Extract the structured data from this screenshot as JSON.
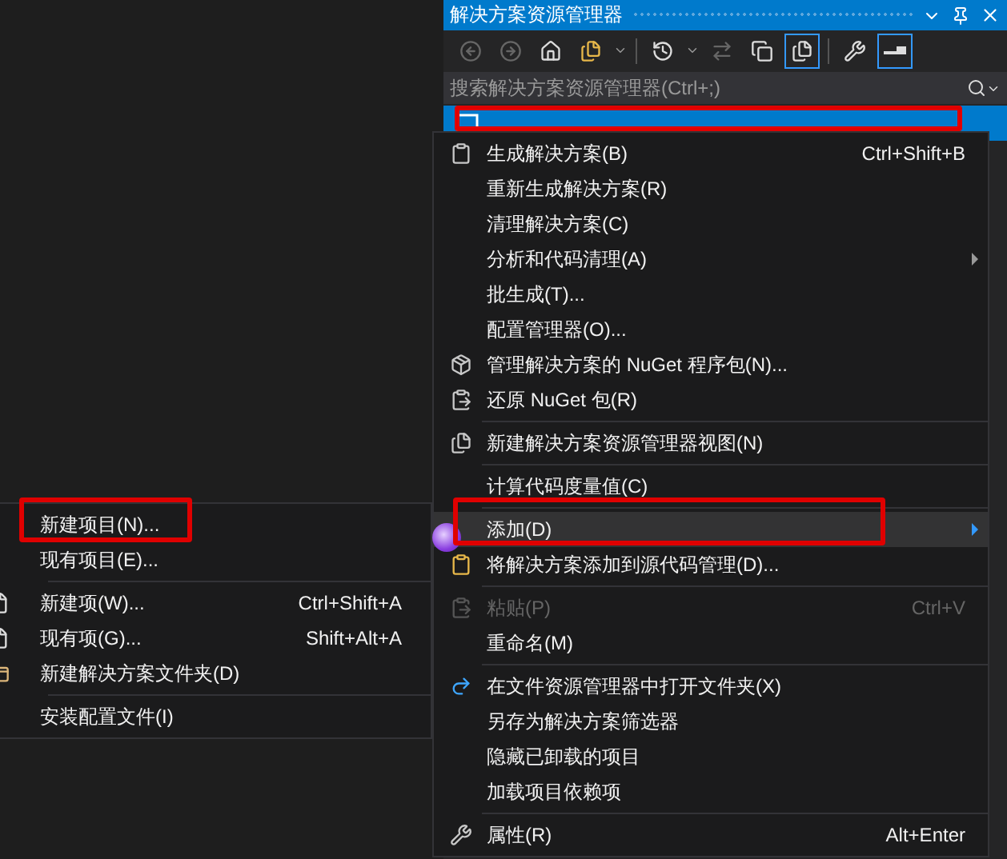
{
  "panel": {
    "title": "解决方案资源管理器",
    "search": {
      "placeholder": "搜索解决方案资源管理器(Ctrl+;)"
    },
    "tree_row": {
      "selected": true
    }
  },
  "context_menu": {
    "items": [
      {
        "kind": "item",
        "label": "生成解决方案(B)",
        "shortcut": "Ctrl+Shift+B",
        "selected": false,
        "disabled": false
      },
      {
        "kind": "item",
        "label": "重新生成解决方案(R)",
        "selected": false,
        "disabled": false
      },
      {
        "kind": "item",
        "label": "清理解决方案(C)",
        "selected": false,
        "disabled": false
      },
      {
        "kind": "item",
        "label": "分析和代码清理(A)",
        "submenu": true,
        "selected": false,
        "disabled": false
      },
      {
        "kind": "item",
        "label": "批生成(T)...",
        "selected": false,
        "disabled": false
      },
      {
        "kind": "item",
        "label": "配置管理器(O)...",
        "selected": false,
        "disabled": false
      },
      {
        "kind": "item",
        "label": "管理解决方案的 NuGet 程序包(N)...",
        "selected": false,
        "disabled": false
      },
      {
        "kind": "item",
        "label": "还原 NuGet 包(R)",
        "selected": false,
        "disabled": false
      },
      {
        "kind": "separator"
      },
      {
        "kind": "item",
        "label": "新建解决方案资源管理器视图(N)",
        "selected": false,
        "disabled": false
      },
      {
        "kind": "separator"
      },
      {
        "kind": "item",
        "label": "计算代码度量值(C)",
        "selected": false,
        "disabled": false
      },
      {
        "kind": "separator"
      },
      {
        "kind": "item",
        "label": "添加(D)",
        "submenu": true,
        "selected": true,
        "disabled": false
      },
      {
        "kind": "item",
        "label": "将解决方案添加到源代码管理(D)...",
        "selected": false,
        "disabled": false
      },
      {
        "kind": "separator"
      },
      {
        "kind": "item",
        "label": "粘贴(P)",
        "shortcut": "Ctrl+V",
        "selected": false,
        "disabled": true
      },
      {
        "kind": "item",
        "label": "重命名(M)",
        "selected": false,
        "disabled": false
      },
      {
        "kind": "separator"
      },
      {
        "kind": "item",
        "label": "在文件资源管理器中打开文件夹(X)",
        "selected": false,
        "disabled": false
      },
      {
        "kind": "item",
        "label": "另存为解决方案筛选器",
        "selected": false,
        "disabled": false
      },
      {
        "kind": "item",
        "label": "隐藏已卸载的项目",
        "selected": false,
        "disabled": false
      },
      {
        "kind": "item",
        "label": "加载项目依赖项",
        "selected": false,
        "disabled": false
      },
      {
        "kind": "separator"
      },
      {
        "kind": "item",
        "label": "属性(R)",
        "shortcut": "Alt+Enter",
        "selected": false,
        "disabled": false
      }
    ]
  },
  "submenu": {
    "items": [
      {
        "kind": "item",
        "label": "新建项目(N)...",
        "selected": false
      },
      {
        "kind": "item",
        "label": "现有项目(E)...",
        "selected": false
      },
      {
        "kind": "separator"
      },
      {
        "kind": "item",
        "label": "新建项(W)...",
        "shortcut": "Ctrl+Shift+A",
        "selected": false
      },
      {
        "kind": "item",
        "label": "现有项(G)...",
        "shortcut": "Shift+Alt+A",
        "selected": false
      },
      {
        "kind": "item",
        "label": "新建解决方案文件夹(D)",
        "selected": false
      },
      {
        "kind": "separator"
      },
      {
        "kind": "item",
        "label": "安装配置文件(I)",
        "selected": false
      }
    ]
  }
}
